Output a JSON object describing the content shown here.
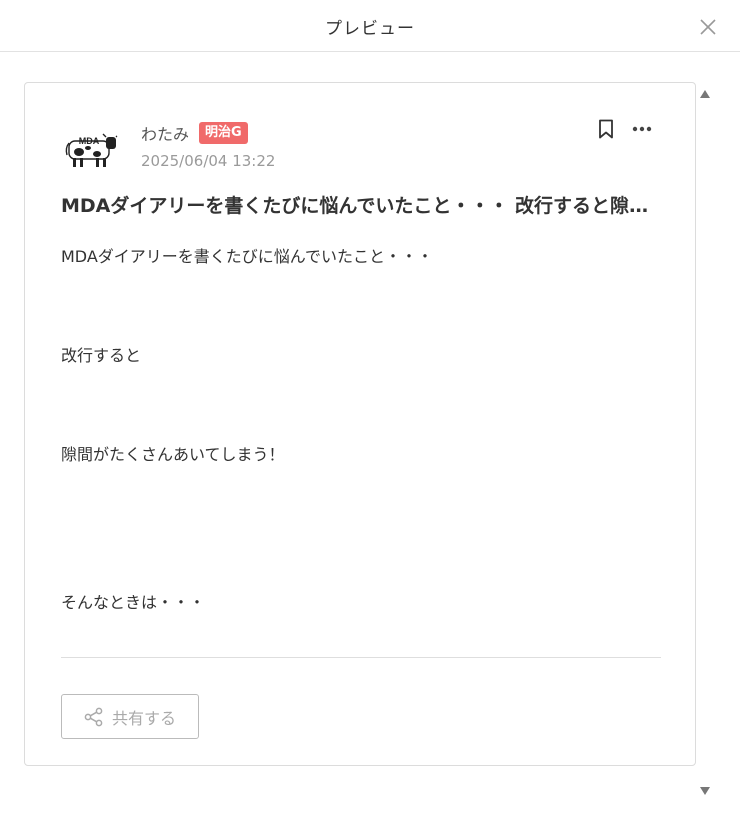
{
  "header": {
    "title": "プレビュー",
    "close_icon": "close-icon"
  },
  "post": {
    "author": "わたみ",
    "group_badge": "明治G",
    "date": "2025/06/04 13:22",
    "avatar_icon": "cow-logo",
    "avatar_text": "MDA",
    "title": "MDAダイアリーを書くたびに悩んでいたこと・・・ 改行すると隙間がたくさんあいてしまう！",
    "body": [
      "MDAダイアリーを書くたびに悩んでいたこと・・・",
      "改行すると",
      "隙間がたくさんあいてしまう！",
      "そんなときは・・・"
    ],
    "share_label": "共有する"
  },
  "icons": {
    "bookmark": "bookmark-icon",
    "more": "more-icon",
    "share": "share-icon"
  },
  "colors": {
    "badge": "#f06a6a",
    "text": "#333333",
    "muted": "#9a9a9a"
  }
}
